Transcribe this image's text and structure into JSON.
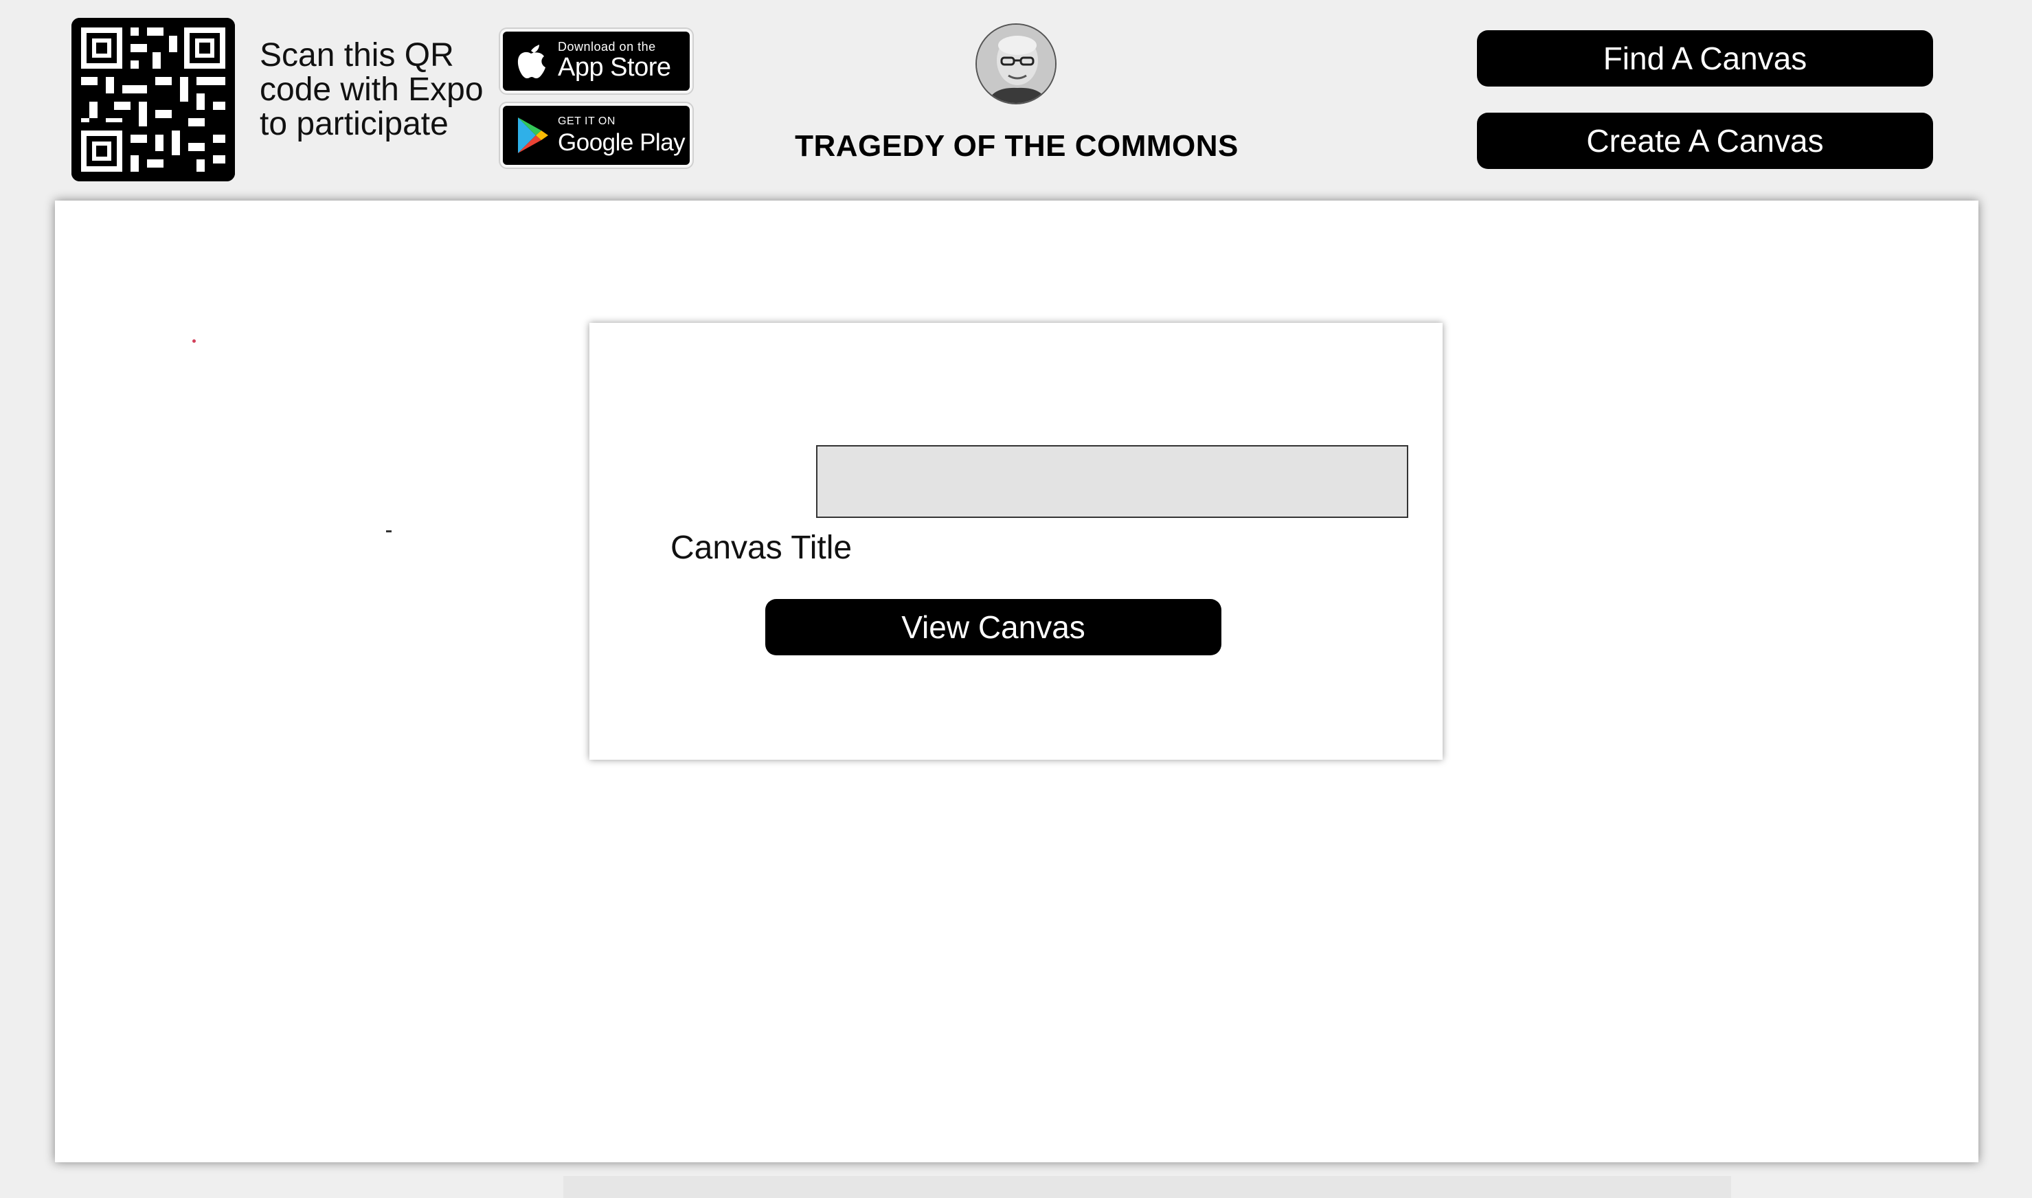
{
  "header": {
    "scan_text": "Scan this QR code with Expo to participate",
    "app_store": {
      "small": "Download on the",
      "big": "App Store"
    },
    "google_play": {
      "small": "GET IT ON",
      "big": "Google Play"
    },
    "title": "TRAGEDY OF THE COMMONS",
    "find_button": "Find A Canvas",
    "create_button": "Create A Canvas"
  },
  "form": {
    "label": "Canvas Title",
    "input_value": "",
    "submit_button": "View Canvas"
  },
  "icons": {
    "qr": "qr-code-icon",
    "apple": "apple-icon",
    "google_play": "google-play-icon",
    "avatar": "user-avatar"
  }
}
